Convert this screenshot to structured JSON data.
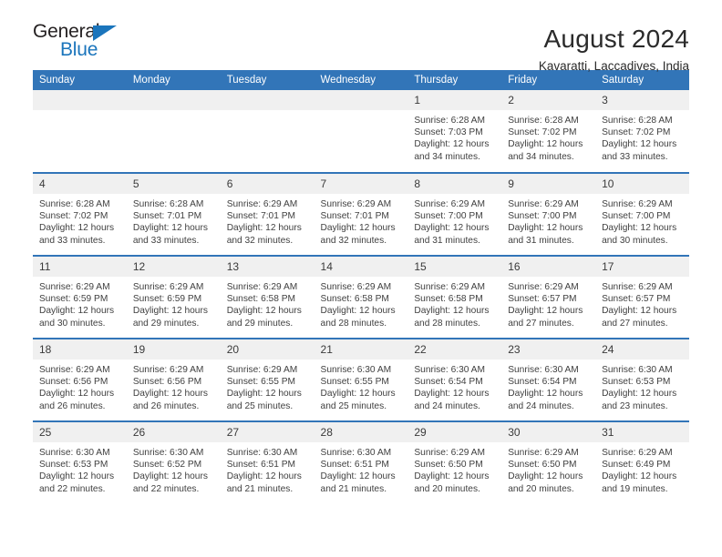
{
  "brand": {
    "name_top": "General",
    "name_bottom": "Blue",
    "color_dark": "#231f20",
    "color_blue": "#1b75bc"
  },
  "header": {
    "title": "August 2024",
    "subtitle": "Kavaratti, Laccadives, India"
  },
  "colors": {
    "header_blue": "#3275b8",
    "daynum_band": "#f0f0f0",
    "text": "#404040"
  },
  "calendar": {
    "weekdays": [
      "Sunday",
      "Monday",
      "Tuesday",
      "Wednesday",
      "Thursday",
      "Friday",
      "Saturday"
    ],
    "weeks": [
      [
        {
          "day": "",
          "info": ""
        },
        {
          "day": "",
          "info": ""
        },
        {
          "day": "",
          "info": ""
        },
        {
          "day": "",
          "info": ""
        },
        {
          "day": "1",
          "info": "Sunrise: 6:28 AM\nSunset: 7:03 PM\nDaylight: 12 hours\nand 34 minutes."
        },
        {
          "day": "2",
          "info": "Sunrise: 6:28 AM\nSunset: 7:02 PM\nDaylight: 12 hours\nand 34 minutes."
        },
        {
          "day": "3",
          "info": "Sunrise: 6:28 AM\nSunset: 7:02 PM\nDaylight: 12 hours\nand 33 minutes."
        }
      ],
      [
        {
          "day": "4",
          "info": "Sunrise: 6:28 AM\nSunset: 7:02 PM\nDaylight: 12 hours\nand 33 minutes."
        },
        {
          "day": "5",
          "info": "Sunrise: 6:28 AM\nSunset: 7:01 PM\nDaylight: 12 hours\nand 33 minutes."
        },
        {
          "day": "6",
          "info": "Sunrise: 6:29 AM\nSunset: 7:01 PM\nDaylight: 12 hours\nand 32 minutes."
        },
        {
          "day": "7",
          "info": "Sunrise: 6:29 AM\nSunset: 7:01 PM\nDaylight: 12 hours\nand 32 minutes."
        },
        {
          "day": "8",
          "info": "Sunrise: 6:29 AM\nSunset: 7:00 PM\nDaylight: 12 hours\nand 31 minutes."
        },
        {
          "day": "9",
          "info": "Sunrise: 6:29 AM\nSunset: 7:00 PM\nDaylight: 12 hours\nand 31 minutes."
        },
        {
          "day": "10",
          "info": "Sunrise: 6:29 AM\nSunset: 7:00 PM\nDaylight: 12 hours\nand 30 minutes."
        }
      ],
      [
        {
          "day": "11",
          "info": "Sunrise: 6:29 AM\nSunset: 6:59 PM\nDaylight: 12 hours\nand 30 minutes."
        },
        {
          "day": "12",
          "info": "Sunrise: 6:29 AM\nSunset: 6:59 PM\nDaylight: 12 hours\nand 29 minutes."
        },
        {
          "day": "13",
          "info": "Sunrise: 6:29 AM\nSunset: 6:58 PM\nDaylight: 12 hours\nand 29 minutes."
        },
        {
          "day": "14",
          "info": "Sunrise: 6:29 AM\nSunset: 6:58 PM\nDaylight: 12 hours\nand 28 minutes."
        },
        {
          "day": "15",
          "info": "Sunrise: 6:29 AM\nSunset: 6:58 PM\nDaylight: 12 hours\nand 28 minutes."
        },
        {
          "day": "16",
          "info": "Sunrise: 6:29 AM\nSunset: 6:57 PM\nDaylight: 12 hours\nand 27 minutes."
        },
        {
          "day": "17",
          "info": "Sunrise: 6:29 AM\nSunset: 6:57 PM\nDaylight: 12 hours\nand 27 minutes."
        }
      ],
      [
        {
          "day": "18",
          "info": "Sunrise: 6:29 AM\nSunset: 6:56 PM\nDaylight: 12 hours\nand 26 minutes."
        },
        {
          "day": "19",
          "info": "Sunrise: 6:29 AM\nSunset: 6:56 PM\nDaylight: 12 hours\nand 26 minutes."
        },
        {
          "day": "20",
          "info": "Sunrise: 6:29 AM\nSunset: 6:55 PM\nDaylight: 12 hours\nand 25 minutes."
        },
        {
          "day": "21",
          "info": "Sunrise: 6:30 AM\nSunset: 6:55 PM\nDaylight: 12 hours\nand 25 minutes."
        },
        {
          "day": "22",
          "info": "Sunrise: 6:30 AM\nSunset: 6:54 PM\nDaylight: 12 hours\nand 24 minutes."
        },
        {
          "day": "23",
          "info": "Sunrise: 6:30 AM\nSunset: 6:54 PM\nDaylight: 12 hours\nand 24 minutes."
        },
        {
          "day": "24",
          "info": "Sunrise: 6:30 AM\nSunset: 6:53 PM\nDaylight: 12 hours\nand 23 minutes."
        }
      ],
      [
        {
          "day": "25",
          "info": "Sunrise: 6:30 AM\nSunset: 6:53 PM\nDaylight: 12 hours\nand 22 minutes."
        },
        {
          "day": "26",
          "info": "Sunrise: 6:30 AM\nSunset: 6:52 PM\nDaylight: 12 hours\nand 22 minutes."
        },
        {
          "day": "27",
          "info": "Sunrise: 6:30 AM\nSunset: 6:51 PM\nDaylight: 12 hours\nand 21 minutes."
        },
        {
          "day": "28",
          "info": "Sunrise: 6:30 AM\nSunset: 6:51 PM\nDaylight: 12 hours\nand 21 minutes."
        },
        {
          "day": "29",
          "info": "Sunrise: 6:29 AM\nSunset: 6:50 PM\nDaylight: 12 hours\nand 20 minutes."
        },
        {
          "day": "30",
          "info": "Sunrise: 6:29 AM\nSunset: 6:50 PM\nDaylight: 12 hours\nand 20 minutes."
        },
        {
          "day": "31",
          "info": "Sunrise: 6:29 AM\nSunset: 6:49 PM\nDaylight: 12 hours\nand 19 minutes."
        }
      ]
    ]
  }
}
